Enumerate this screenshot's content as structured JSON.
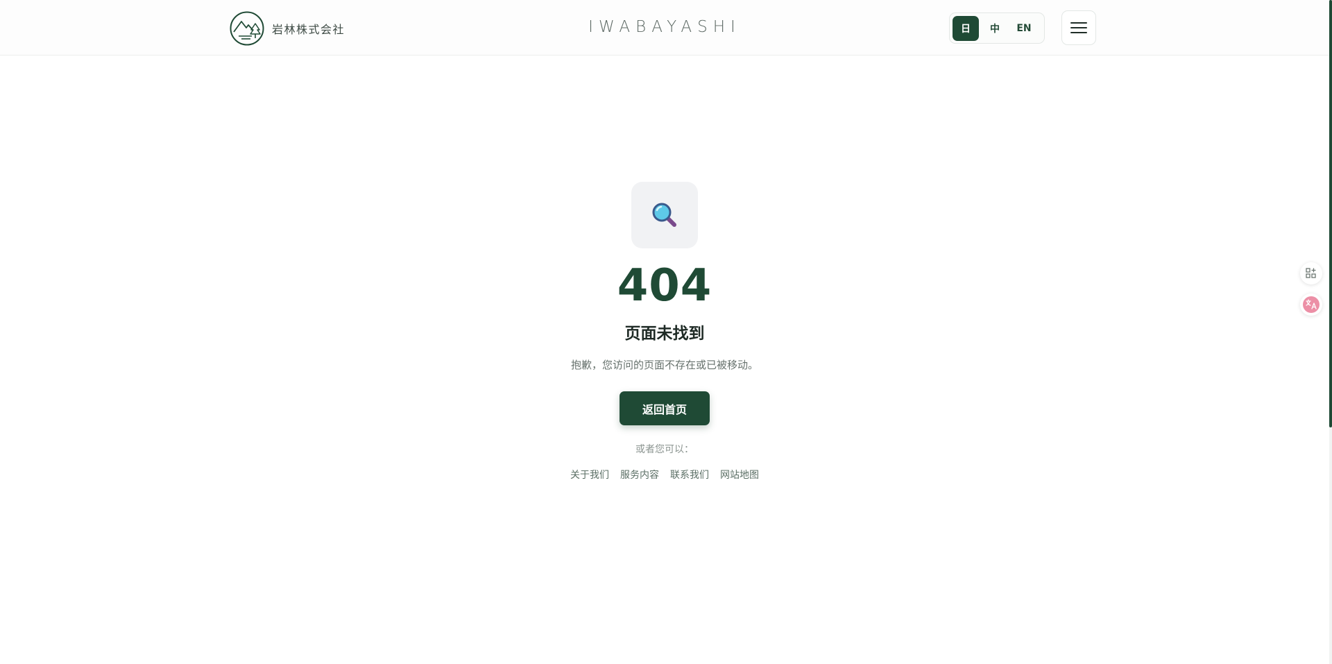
{
  "header": {
    "brand_name": "岩林株式会社",
    "wordmark": "IWABAYASHI",
    "languages": [
      {
        "label": "日",
        "active": true
      },
      {
        "label": "中",
        "active": false
      },
      {
        "label": "EN",
        "active": false
      }
    ],
    "menu_icon": "hamburger-icon"
  },
  "main": {
    "icon": "magnifying-glass-icon",
    "code": "404",
    "title": "页面未找到",
    "description": "抱歉，您访问的页面不存在或已被移动。",
    "home_button": "返回首页",
    "or_text": "或者您可以：",
    "links": [
      "关于我们",
      "服务内容",
      "联系我们",
      "网站地图"
    ]
  },
  "side_widgets": [
    "apps-add-icon",
    "translate-icon"
  ],
  "colors": {
    "brand_green": "#1f4a35",
    "icon_box_bg": "#f1f2f4",
    "text_dark": "#1e2a25",
    "text_muted": "#66716c"
  }
}
